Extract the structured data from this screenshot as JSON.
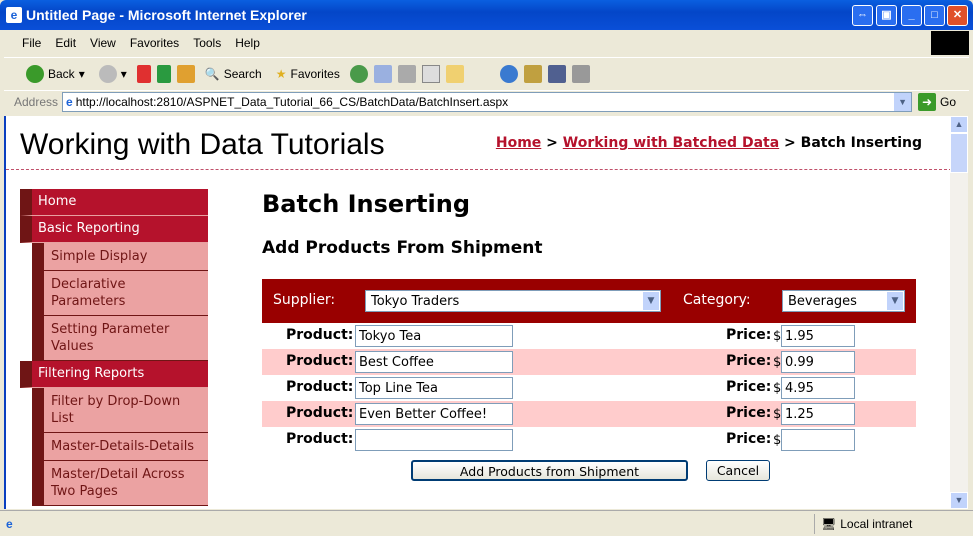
{
  "window": {
    "title": "Untitled Page - Microsoft Internet Explorer"
  },
  "menu": [
    "File",
    "Edit",
    "View",
    "Favorites",
    "Tools",
    "Help"
  ],
  "toolbar": {
    "back": "Back",
    "search": "Search",
    "favorites": "Favorites"
  },
  "address": {
    "label": "Address",
    "url": "http://localhost:2810/ASPNET_Data_Tutorial_66_CS/BatchData/BatchInsert.aspx",
    "go": "Go"
  },
  "status": {
    "zone": "Local intranet"
  },
  "site": {
    "title": "Working with Data Tutorials"
  },
  "breadcrumb": {
    "home": "Home",
    "sep1": " > ",
    "section": "Working with Batched Data",
    "sep2": " > ",
    "current": "Batch Inserting"
  },
  "sidebar": [
    {
      "label": "Home",
      "level": "top"
    },
    {
      "label": "Basic Reporting",
      "level": "top"
    },
    {
      "label": "Simple Display",
      "level": "sub"
    },
    {
      "label": "Declarative Parameters",
      "level": "sub"
    },
    {
      "label": "Setting Parameter Values",
      "level": "sub"
    },
    {
      "label": "Filtering Reports",
      "level": "top"
    },
    {
      "label": "Filter by Drop-Down List",
      "level": "sub"
    },
    {
      "label": "Master-Details-Details",
      "level": "sub"
    },
    {
      "label": "Master/Detail Across Two Pages",
      "level": "sub"
    }
  ],
  "main": {
    "heading": "Batch Inserting",
    "subheading": "Add Products From Shipment",
    "supplier_label": "Supplier:",
    "supplier_value": "Tokyo Traders",
    "category_label": "Category:",
    "category_value": "Beverages",
    "product_label": "Product:",
    "price_label": "Price:",
    "currency": "$",
    "rows": [
      {
        "product": "Tokyo Tea",
        "price": "1.95"
      },
      {
        "product": "Best Coffee",
        "price": "0.99"
      },
      {
        "product": "Top Line Tea",
        "price": "4.95"
      },
      {
        "product": "Even Better Coffee!",
        "price": "1.25"
      },
      {
        "product": "",
        "price": ""
      }
    ],
    "add_button": "Add Products from Shipment",
    "cancel_button": "Cancel"
  },
  "colors": {
    "accent": "#b5122c",
    "header_bar": "#990000",
    "alt_row": "#ffcccc",
    "sub_menu": "#eba2a2"
  }
}
